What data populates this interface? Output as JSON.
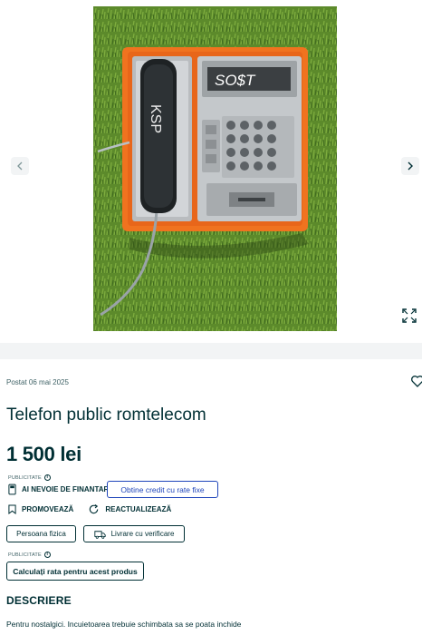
{
  "gallery": {
    "photo_alt": "Telefon public romtelecom",
    "display_text": "SO$T",
    "handset_text": "KSP",
    "prev_icon": "chevron-left-icon",
    "next_icon": "chevron-right-icon",
    "expand_icon": "expand-icon"
  },
  "listing": {
    "posted": "Postat 06 mai 2025",
    "title": "Telefon public romtelecom",
    "price": "1 500 lei",
    "ad_label": "PUBLICITATE",
    "info_icon": "i",
    "financing_label": "AI NEVOIE DE FINANTARE?",
    "credit_button": "Obtine credit cu rate fixe",
    "promote_label": "PROMOVEAZĂ",
    "refresh_label": "REACTUALIZEAZĂ",
    "seller_type": "Persoana fizica",
    "delivery_label": "Livrare cu verificare",
    "ad_label_2": "PUBLICITATE",
    "rate_button": "Calculați rata pentru acest produs",
    "description_heading": "DESCRIERE",
    "description": "Pentru nostalgici. Incuietoarea trebuie schimbata sa se poata inchide"
  },
  "colors": {
    "primary_text": "#002f34",
    "link_blue": "#1f45ba",
    "phone_orange": "#f0731f",
    "grass_green": "#5f8a2e"
  }
}
